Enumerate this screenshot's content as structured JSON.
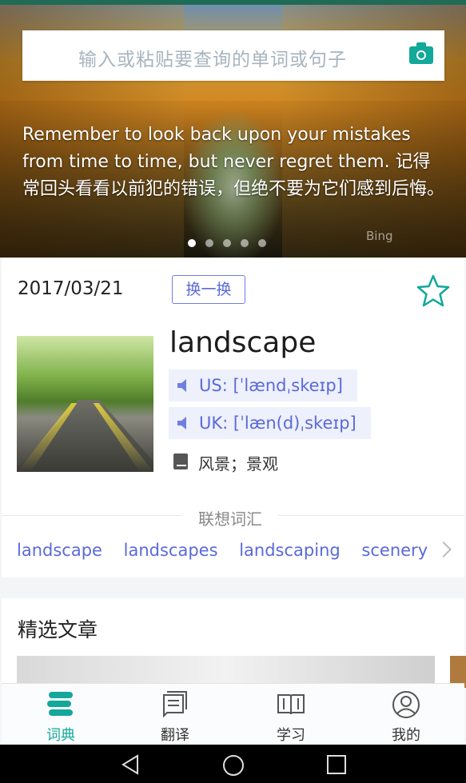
{
  "search": {
    "placeholder": "输入或粘贴要查询的单词或句子"
  },
  "hero": {
    "quote": "Remember to look back upon your mistakes from time to time, but never regret them. 记得常回头看看以前犯的错误，但绝不要为它们感到后悔。",
    "source": "Bing",
    "pagination_active": 1,
    "pagination_total": 5
  },
  "daily": {
    "date": "2017/03/21",
    "swap_label": "换一换",
    "word": "landscape",
    "us_pron": "US: [ˈlændˌskeɪp]",
    "uk_pron": "UK: [ˈlæn(d)ˌskeɪp]",
    "meaning": "风景；景观"
  },
  "related": {
    "title": "联想词汇",
    "words": [
      "landscape",
      "landscapes",
      "landscaping",
      "scenery"
    ]
  },
  "articles": {
    "title": "精选文章"
  },
  "tabs": [
    {
      "label": "词典",
      "icon": "dictionary-icon",
      "active": true
    },
    {
      "label": "翻译",
      "icon": "translate-icon",
      "active": false
    },
    {
      "label": "学习",
      "icon": "book-open-icon",
      "active": false
    },
    {
      "label": "我的",
      "icon": "user-icon",
      "active": false
    }
  ],
  "colors": {
    "accent": "#12a89a",
    "link": "#5a6ad9"
  }
}
